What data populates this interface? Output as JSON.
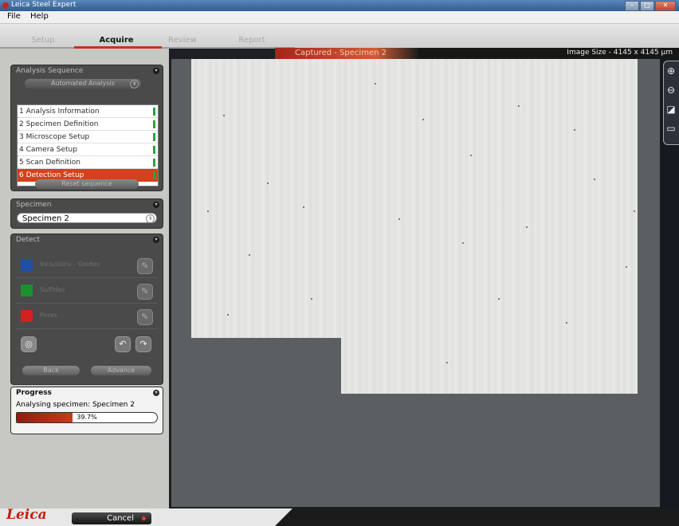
{
  "window": {
    "title": "Leica Steel Expert",
    "controls": [
      "–",
      "□",
      "✕"
    ]
  },
  "menu": [
    "File",
    "Help"
  ],
  "tabs": [
    {
      "label": "Setup",
      "active": false
    },
    {
      "label": "Acquire",
      "active": true
    },
    {
      "label": "Review",
      "active": false
    },
    {
      "label": "Report",
      "active": false
    }
  ],
  "viewer": {
    "caption": "Captured - Specimen 2",
    "image_size": "Image Size - 4145 x 4145 µm"
  },
  "analysis_sequence": {
    "title": "Analysis Sequence",
    "mode": "Automated Analysis",
    "items": [
      {
        "label": "1 Analysis Information",
        "active": false
      },
      {
        "label": "2 Specimen Definition",
        "active": false
      },
      {
        "label": "3 Microscope Setup",
        "active": false
      },
      {
        "label": "4 Camera Setup",
        "active": false
      },
      {
        "label": "5 Scan Definition",
        "active": false
      },
      {
        "label": "6 Detection Setup",
        "active": true
      }
    ],
    "reset_label": "Reset sequence"
  },
  "specimen": {
    "title": "Specimen",
    "selected": "Specimen 2"
  },
  "detect": {
    "title": "Detect",
    "rows": [
      {
        "color": "#1f4fa8",
        "label": "Inclusions - Oxides"
      },
      {
        "color": "#1f8f2e",
        "label": "Sulfides"
      },
      {
        "color": "#d42020",
        "label": "Pores"
      }
    ],
    "back_label": "Back",
    "advance_label": "Advance"
  },
  "progress": {
    "title": "Progress",
    "status": "Analysing specimen: Specimen 2",
    "percent_text": "39.7%",
    "fraction": 0.397
  },
  "footer": {
    "logo": "Leica",
    "cancel_label": "Cancel"
  },
  "colors": {
    "accent": "#c0391f",
    "panel": "#4a4a4a",
    "sidebar": "#c7c7c3"
  },
  "right_tools": [
    "zoom-in-icon",
    "zoom-out-icon",
    "fit-icon",
    "scale-icon"
  ]
}
